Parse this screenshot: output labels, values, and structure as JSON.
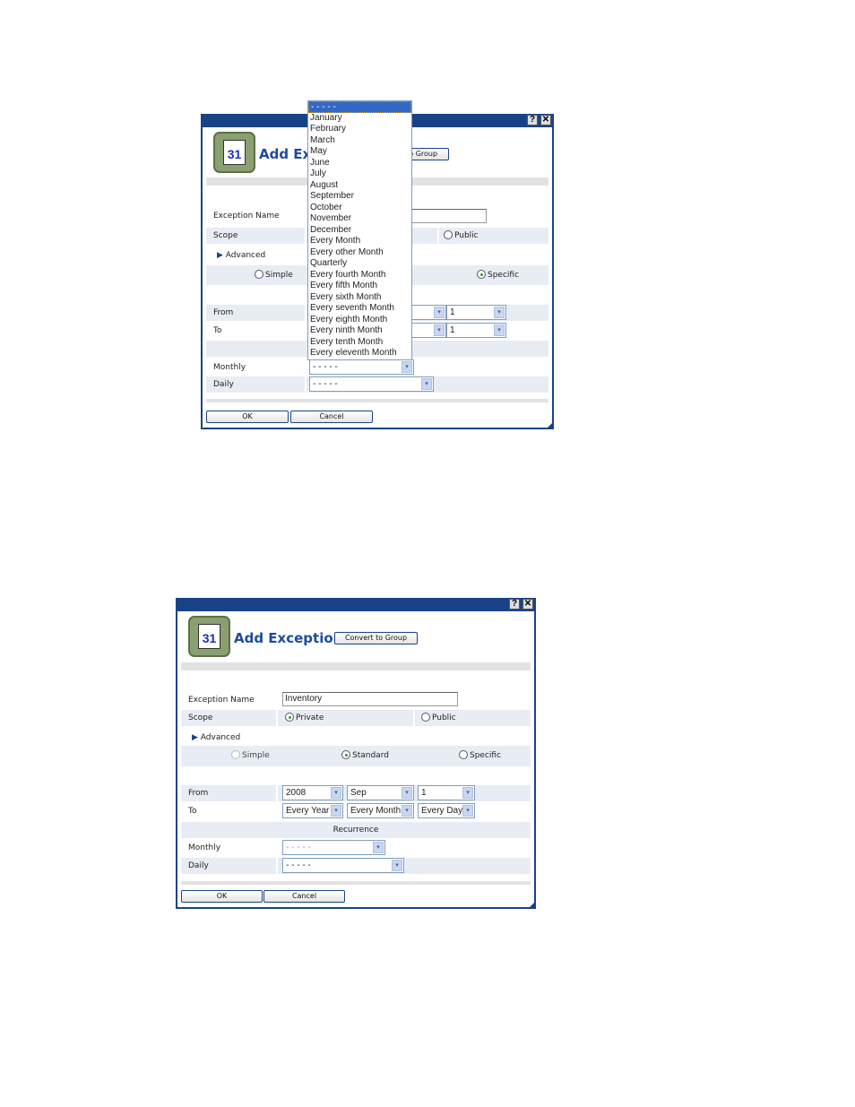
{
  "dialog1": {
    "title": "Add Exception",
    "convert": "Convert to Group",
    "help": "?",
    "close": "✕",
    "name_label": "Exception Name",
    "name_value": "",
    "scope_label": "Scope",
    "public": "Public",
    "advanced": "Advanced",
    "simple": "Simple",
    "specific": "Specific",
    "from_label": "From",
    "to_label": "To",
    "from_day": "1",
    "to_day": "1",
    "monthly_label": "Monthly",
    "monthly_value": "- - - - -",
    "daily_label": "Daily",
    "daily_value": "- - - - -",
    "ok": "OK",
    "cancel": "Cancel",
    "dropdown_options": [
      "- - - - -",
      "January",
      "February",
      "March",
      "May",
      "June",
      "July",
      "August",
      "September",
      "October",
      "November",
      "December",
      "Every Month",
      "Every other Month",
      "Quarterly",
      "Every fourth Month",
      "Every fifth Month",
      "Every sixth Month",
      "Every seventh Month",
      "Every eighth Month",
      "Every ninth Month",
      "Every tenth Month",
      "Every eleventh Month"
    ],
    "dropdown_highlighted": "- - - - -"
  },
  "dialog2": {
    "title": "Add Exception",
    "convert": "Convert to Group",
    "help": "?",
    "close": "✕",
    "name_label": "Exception Name",
    "name_value": "Inventory",
    "scope_label": "Scope",
    "private": "Private",
    "public": "Public",
    "advanced": "Advanced",
    "simple": "Simple",
    "standard": "Standard",
    "specific": "Specific",
    "from_label": "From",
    "from_year": "2008",
    "from_month": "Sep",
    "from_day": "1",
    "to_label": "To",
    "to_year": "Every Year",
    "to_month": "Every Month",
    "to_day": "Every Day",
    "recurrence": "Recurrence",
    "monthly_label": "Monthly",
    "monthly_value": "- - - - -",
    "daily_label": "Daily",
    "daily_value": "- - - - -",
    "ok": "OK",
    "cancel": "Cancel"
  },
  "colors": {
    "titlebar": "#1a4387",
    "title_text": "#1c4aa0",
    "row_shade": "#e8ecf4",
    "highlight": "#3168c8"
  }
}
